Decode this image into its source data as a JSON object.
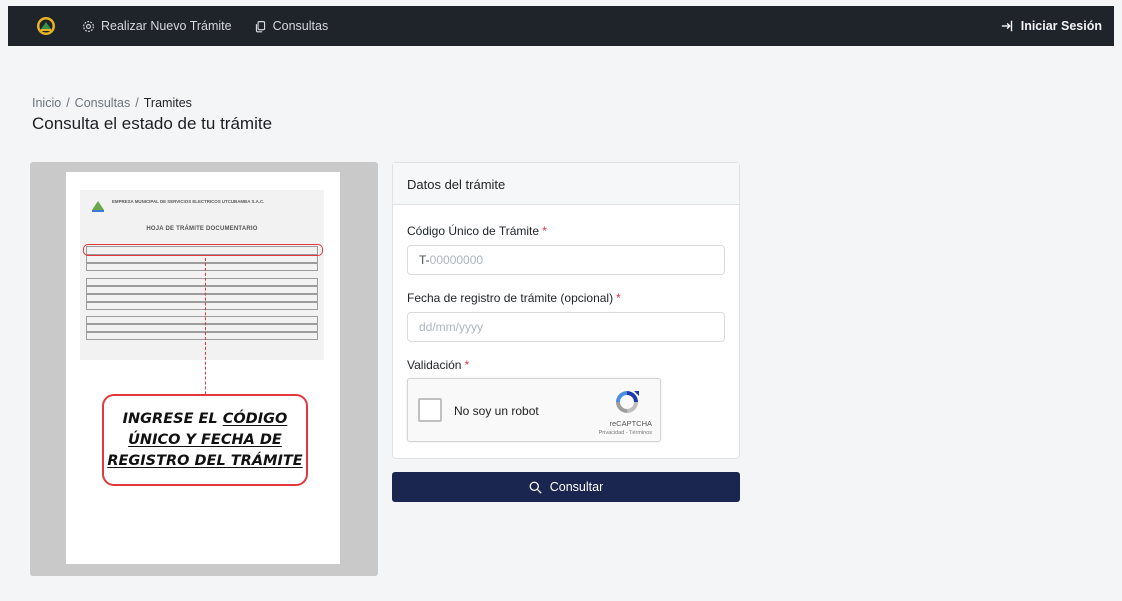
{
  "navbar": {
    "new_procedure": "Realizar Nuevo Trámite",
    "queries": "Consultas",
    "login": "Iniciar Sesión"
  },
  "breadcrumb": {
    "home": "Inicio",
    "separator": "/",
    "queries": "Consultas",
    "current": "Tramites"
  },
  "page_title": "Consulta el estado de tu trámite",
  "illustration": {
    "doc_company": "EMPRESA MUNICIPAL DE SERVICIOS ELECTRICOS UTCUBAMBA S.A.C.",
    "doc_title": "HOJA DE TRÁMITE DOCUMENTARIO",
    "callout_line1_a": "INGRESE EL ",
    "callout_line1_b": "CÓDIGO",
    "callout_line2": "ÚNICO Y FECHA DE",
    "callout_line3": "REGISTRO DEL TRÁMITE"
  },
  "form": {
    "header": "Datos del trámite",
    "code_label": "Código Único de Trámite",
    "code_prefix": "T-",
    "code_placeholder": "00000000",
    "date_label": "Fecha de registro de trámite (opcional)",
    "date_placeholder": "dd/mm/yyyy",
    "validation_label": "Validación",
    "required_mark": "*",
    "recaptcha": {
      "checkbox_label": "No soy un robot",
      "brand": "reCAPTCHA",
      "terms": "Privacidad - Términos"
    },
    "submit_label": "Consultar"
  },
  "colors": {
    "navbar_bg": "#1f232a",
    "primary_button": "#1a2550",
    "required": "#dc3545",
    "callout_red": "#e2383d"
  }
}
